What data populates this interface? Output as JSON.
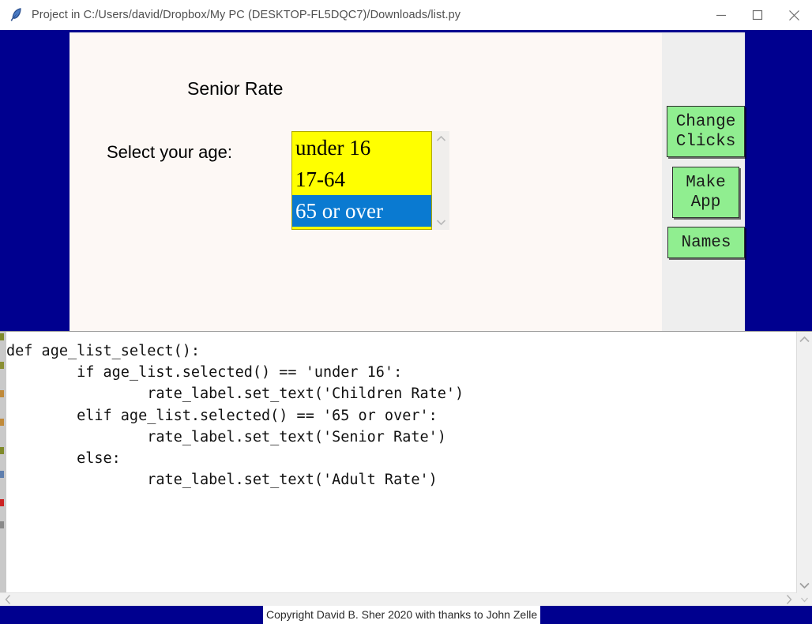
{
  "window": {
    "title": "Project in C:/Users/david/Dropbox/My PC (DESKTOP-FL5DQC7)/Downloads/list.py",
    "icon": "python-feather-icon",
    "controls": {
      "minimize": "minimize-icon",
      "maximize": "maximize-icon",
      "close": "close-icon"
    }
  },
  "app_preview": {
    "rate_label": "Senior Rate",
    "age_prompt": "Select your age:",
    "listbox": {
      "name": "age-list",
      "items": [
        {
          "label": "under 16",
          "selected": false
        },
        {
          "label": "17-64",
          "selected": false
        },
        {
          "label": "65 or over",
          "selected": true
        }
      ],
      "background_color": "#ffff00",
      "selection_color": "#0a7ad1",
      "scroll_up": "chevron-up-icon",
      "scroll_down": "chevron-down-icon"
    },
    "buttons": [
      {
        "id": "change-clicks",
        "label": "Change\nClicks"
      },
      {
        "id": "make-app",
        "label": "Make\nApp"
      },
      {
        "id": "names",
        "label": "Names"
      }
    ],
    "button_color": "#90ee90",
    "desktop_color": "#00008f",
    "canvas_color": "#fdf8f5"
  },
  "editor": {
    "code": "def age_list_select():\n        if age_list.selected() == 'under 16':\n                rate_label.set_text('Children Rate')\n        elif age_list.selected() == '65 or over':\n                rate_label.set_text('Senior Rate')\n        else:\n                rate_label.set_text('Adult Rate')",
    "vscroll_up": "chevron-up-icon",
    "vscroll_down": "chevron-down-icon",
    "hscroll_left": "chevron-left-icon",
    "hscroll_right": "chevron-right-icon"
  },
  "statusbar": {
    "copyright": "Copyright David B. Sher 2020 with thanks to John Zelle",
    "background_color": "#00008f"
  }
}
